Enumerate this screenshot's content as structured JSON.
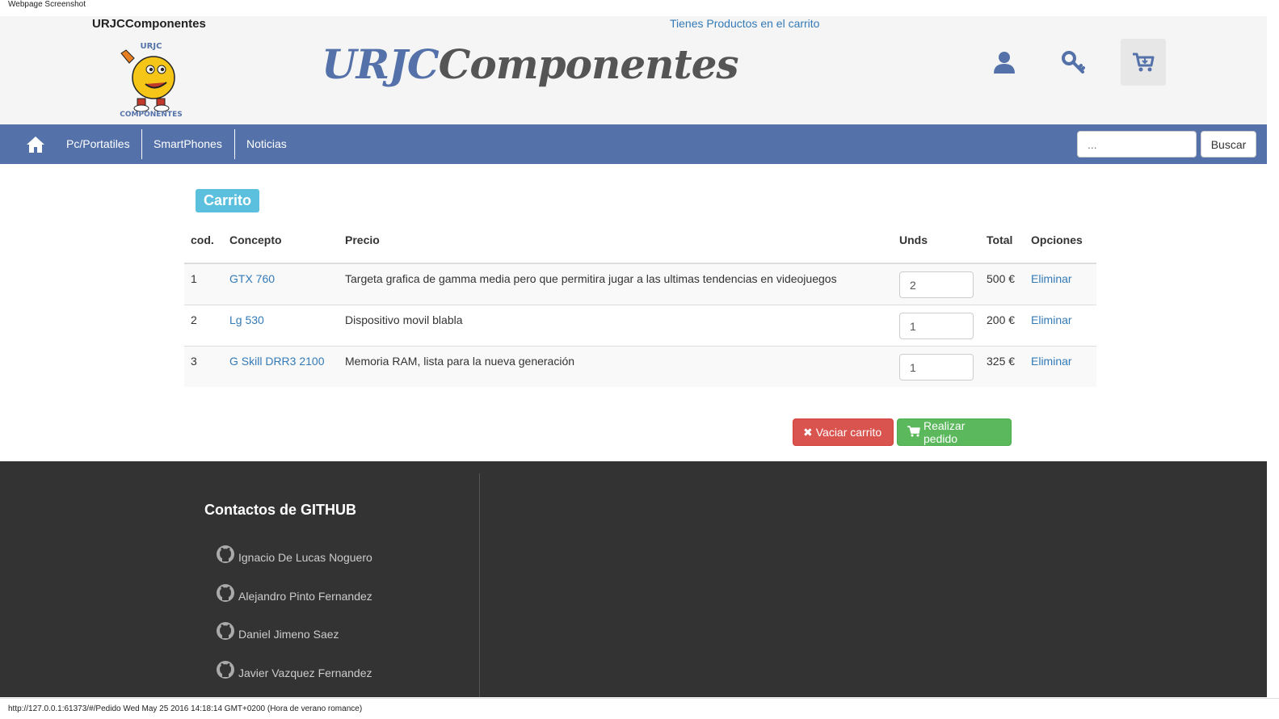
{
  "caption": "Webpage Screenshot",
  "header": {
    "brand": "URJCComponentes",
    "cart_message": "Tienes Productos en el carrito",
    "banner_part1": "URJC",
    "banner_part2": "Componentes",
    "logo_text_top": "URJC",
    "logo_text_bottom": "COMPONENTES"
  },
  "nav": {
    "items": [
      {
        "label": "Pc/Portatiles"
      },
      {
        "label": "SmartPhones"
      },
      {
        "label": "Noticias"
      }
    ],
    "search_placeholder": "...",
    "search_button": "Buscar"
  },
  "cart": {
    "title": "Carrito",
    "columns": [
      "cod.",
      "Concepto",
      "Precio",
      "Unds",
      "Total",
      "Opciones"
    ],
    "rows": [
      {
        "cod": "1",
        "concepto": "GTX 760",
        "precio": "Targeta grafica de gamma media pero que permitira jugar a las ultimas tendencias en videojuegos",
        "unds": "2",
        "total": "500 €",
        "opcion": "Eliminar"
      },
      {
        "cod": "2",
        "concepto": "Lg 530",
        "precio": "Dispositivo movil blabla",
        "unds": "1",
        "total": "200 €",
        "opcion": "Eliminar"
      },
      {
        "cod": "3",
        "concepto": "G Skill DRR3 2100",
        "precio": "Memoria RAM, lista para la nueva generación",
        "unds": "1",
        "total": "325 €",
        "opcion": "Eliminar"
      }
    ],
    "empty_button": "Vaciar carrito",
    "order_button": "Realizar pedido"
  },
  "footer": {
    "title": "Contactos de GITHUB",
    "contacts": [
      "Ignacio De Lucas Noguero",
      "Alejandro Pinto Fernandez",
      "Daniel Jimeno Saez",
      "Javier Vazquez Fernandez"
    ]
  },
  "status": "http://127.0.0.1:61373/#/Pedido Wed May 25 2016 14:18:14 GMT+0200 (Hora de verano romance)",
  "colors": {
    "accent": "#5472a9",
    "link": "#337ab7",
    "danger": "#d9534f",
    "success": "#5cb85c",
    "badge": "#5bc0de",
    "footer": "#333333"
  }
}
